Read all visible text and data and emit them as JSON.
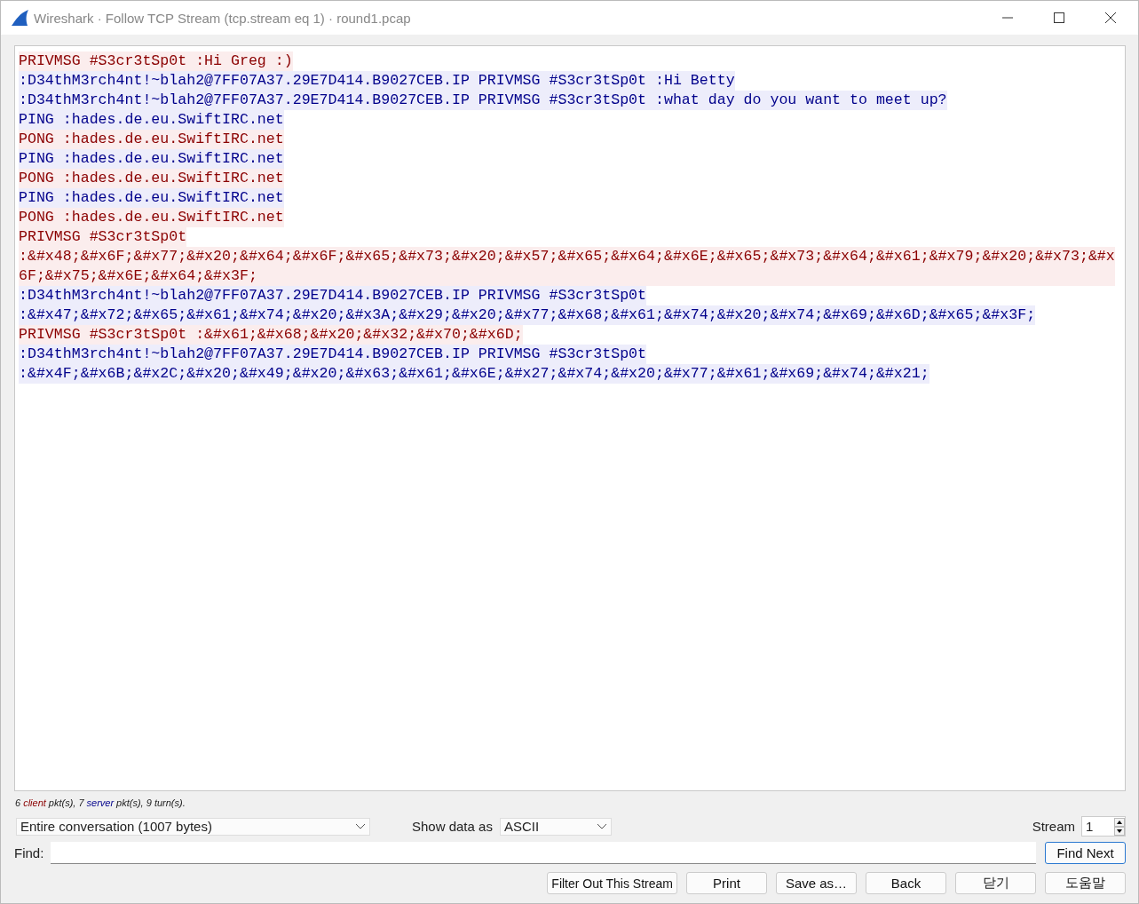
{
  "window": {
    "title": "Wireshark · Follow TCP Stream (tcp.stream eq 1) · round1.pcap"
  },
  "stream_lines": [
    {
      "kind": "client",
      "text": "PRIVMSG #S3cr3tSp0t :Hi Greg :)"
    },
    {
      "kind": "server",
      "text": ":D34thM3rch4nt!~blah2@7FF07A37.29E7D414.B9027CEB.IP PRIVMSG #S3cr3tSp0t :Hi Betty"
    },
    {
      "kind": "server",
      "text": ":D34thM3rch4nt!~blah2@7FF07A37.29E7D414.B9027CEB.IP PRIVMSG #S3cr3tSp0t :what day do you want to meet up?"
    },
    {
      "kind": "server",
      "text": "PING :hades.de.eu.SwiftIRC.net"
    },
    {
      "kind": "client",
      "text": "PONG :hades.de.eu.SwiftIRC.net"
    },
    {
      "kind": "server",
      "text": "PING :hades.de.eu.SwiftIRC.net"
    },
    {
      "kind": "client",
      "text": "PONG :hades.de.eu.SwiftIRC.net"
    },
    {
      "kind": "server",
      "text": "PING :hades.de.eu.SwiftIRC.net"
    },
    {
      "kind": "client",
      "text": "PONG :hades.de.eu.SwiftIRC.net"
    },
    {
      "kind": "client",
      "text": "PRIVMSG #S3cr3tSp0t"
    },
    {
      "kind": "client",
      "text": ":&#x48;&#x6F;&#x77;&#x20;&#x64;&#x6F;&#x65;&#x73;&#x20;&#x57;&#x65;&#x64;&#x6E;&#x65;&#x73;&#x64;&#x61;&#x79;&#x20;&#x73;&#x6F;&#x75;&#x6E;&#x64;&#x3F;"
    },
    {
      "kind": "server",
      "text": ":D34thM3rch4nt!~blah2@7FF07A37.29E7D414.B9027CEB.IP PRIVMSG #S3cr3tSp0t"
    },
    {
      "kind": "server",
      "text": ":&#x47;&#x72;&#x65;&#x61;&#x74;&#x20;&#x3A;&#x29;&#x20;&#x77;&#x68;&#x61;&#x74;&#x20;&#x74;&#x69;&#x6D;&#x65;&#x3F;"
    },
    {
      "kind": "client",
      "text": "PRIVMSG #S3cr3tSp0t :&#x61;&#x68;&#x20;&#x32;&#x70;&#x6D;"
    },
    {
      "kind": "server",
      "text": ":D34thM3rch4nt!~blah2@7FF07A37.29E7D414.B9027CEB.IP PRIVMSG #S3cr3tSp0t"
    },
    {
      "kind": "server",
      "text": ":&#x4F;&#x6B;&#x2C;&#x20;&#x49;&#x20;&#x63;&#x61;&#x6E;&#x27;&#x74;&#x20;&#x77;&#x61;&#x69;&#x74;&#x21;"
    }
  ],
  "summary": [
    {
      "kind": "plain",
      "text": "6"
    },
    {
      "kind": "client",
      "text": "client"
    },
    {
      "kind": "plain",
      "text": "pkt(s), 7"
    },
    {
      "kind": "server",
      "text": "server"
    },
    {
      "kind": "plain",
      "text": "pkt(s), 9 turn(s)."
    }
  ],
  "conversation_select": {
    "value": "Entire conversation (1007 bytes)"
  },
  "show_data_as": {
    "label": "Show data as",
    "value": "ASCII"
  },
  "stream": {
    "label": "Stream",
    "value": "1"
  },
  "find": {
    "label": "Find:",
    "button": "Find Next"
  },
  "buttons": [
    "Filter Out This Stream",
    "Print",
    "Save as…",
    "Back",
    "닫기",
    "도움말"
  ]
}
